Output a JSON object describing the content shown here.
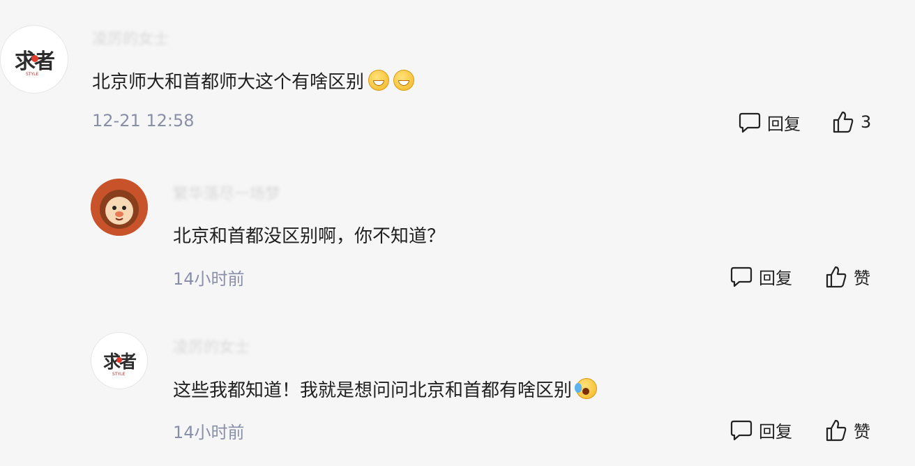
{
  "comments": [
    {
      "username": "凌厉的女士",
      "avatar_text": "求者",
      "avatar_sub": "STYLE",
      "text": "北京师大和首都师大这个有啥区别",
      "emojis": [
        "grin-emoji",
        "grin-emoji"
      ],
      "time": "12-21 12:58",
      "reply_label": "回复",
      "like_label": "3"
    },
    {
      "username": "繁华落尽一场梦",
      "avatar_icon": "lion-icon",
      "text": "北京和首都没区别啊，你不知道？",
      "time": "14小时前",
      "reply_label": "回复",
      "like_label": "赞"
    },
    {
      "username": "凌厉的女士",
      "avatar_text": "求者",
      "avatar_sub": "STYLE",
      "text": "这些我都知道！我就是想问问北京和首都有啥区别",
      "emojis": [
        "crying-laugh-emoji"
      ],
      "time": "14小时前",
      "reply_label": "回复",
      "like_label": "赞"
    }
  ],
  "colors": {
    "background": "#f6f6f6",
    "time_text": "#8a8fa8",
    "body_text": "#1f1f1f",
    "lion_avatar": "#c8532b"
  }
}
